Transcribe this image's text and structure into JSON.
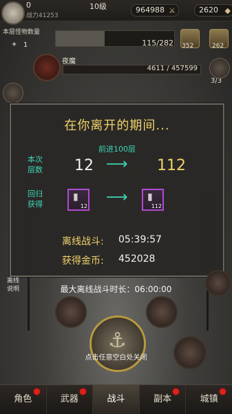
{
  "top_bar": {
    "player_level_short": "0",
    "combat_power": "战力41253",
    "rank": "10级",
    "resource1": "964988",
    "resource2": "2620",
    "resource1_icon": "crossed-swords-icon",
    "resource2_icon": "gem-icon"
  },
  "stage": {
    "label": "本层怪物数量",
    "count": "1",
    "progress_text": "115/282",
    "progress_fraction": 0.41,
    "chest1_count": "352",
    "chest2_count": "262"
  },
  "boss": {
    "name": "夜魔",
    "hp_text": "4611 / 457599",
    "hp_fraction": 0.01
  },
  "side_values": {
    "right_badge": "3/3"
  },
  "modal": {
    "title": "在你离开的期间...",
    "advance_text": "前进100层",
    "floors_label": "本次层数",
    "floors_old": "12",
    "floors_new": "112",
    "return_label": "回归获得",
    "item_old_count": "12",
    "item_new_count": "112",
    "offline_battle_label": "离线战斗:",
    "offline_battle_value": "05:39:57",
    "gold_label": "获得金币:",
    "gold_value": "452028"
  },
  "max_offline": "最大离线战斗时长：06:00:00",
  "close_hint": "点击任意空白处关闭",
  "left_side_label": "离线说明",
  "nav": {
    "tabs": [
      "角色",
      "武器",
      "战斗",
      "副本",
      "城镇"
    ],
    "active_index": 2
  },
  "colors": {
    "accent_gold": "#f0d26a",
    "accent_teal": "#3dd6b6",
    "notification_red": "#d9231c"
  }
}
